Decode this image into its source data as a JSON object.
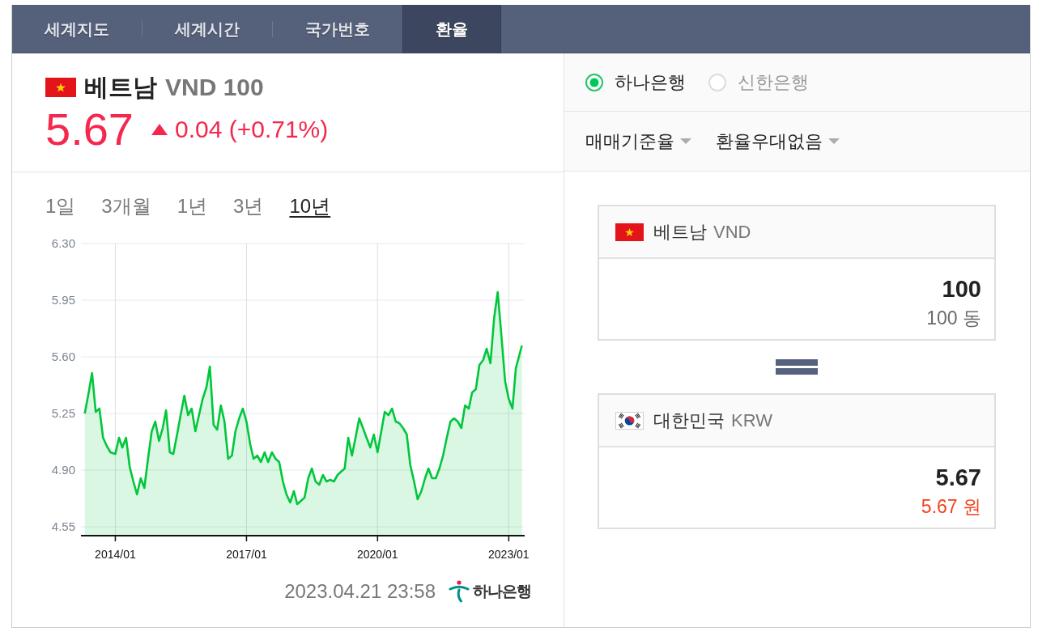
{
  "tabs": [
    {
      "label": "세계지도",
      "selected": false
    },
    {
      "label": "세계시간",
      "selected": false
    },
    {
      "label": "국가번호",
      "selected": false
    },
    {
      "label": "환율",
      "selected": true
    }
  ],
  "quote": {
    "country": "베트남",
    "currency": "VND 100",
    "price": "5.67",
    "change": {
      "up": true,
      "text": "0.04 (+0.71%)"
    }
  },
  "chart_panel": {
    "periods": [
      {
        "label": "1일",
        "selected": false
      },
      {
        "label": "3개월",
        "selected": false
      },
      {
        "label": "1년",
        "selected": false
      },
      {
        "label": "3년",
        "selected": false
      },
      {
        "label": "10년",
        "selected": true
      }
    ],
    "chart_data": [
      {
        "type": "area",
        "color": "#00c73c",
        "grid": true,
        "xlim": [
          "2013-03-20",
          "2023-05-14"
        ],
        "ylim": [
          4.5,
          6.3
        ],
        "yticks": [
          {
            "value": 4.55,
            "label": "4.55"
          },
          {
            "value": 4.9,
            "label": "4.90"
          },
          {
            "value": 5.25,
            "label": "5.25"
          },
          {
            "value": 5.6,
            "label": "5.60"
          },
          {
            "value": 5.95,
            "label": "5.95"
          },
          {
            "value": 6.3,
            "label": "6.30"
          }
        ],
        "xticks": [
          {
            "value": "2014-01-01",
            "label": "2014/01"
          },
          {
            "value": "2017-01-01",
            "label": "2017/01"
          },
          {
            "value": "2020-01-01",
            "label": "2020/01"
          },
          {
            "value": "2023-01-01",
            "label": "2023/01"
          }
        ],
        "x": [
          "2013-04-21",
          "2013-05-21",
          "2013-06-21",
          "2013-07-21",
          "2013-08-21",
          "2013-09-21",
          "2013-10-21",
          "2013-11-21",
          "2014-01-01",
          "2014-02-01",
          "2014-03-01",
          "2014-04-01",
          "2014-05-01",
          "2014-06-01",
          "2014-07-01",
          "2014-08-01",
          "2014-09-01",
          "2014-10-01",
          "2014-11-01",
          "2014-12-01",
          "2015-01-01",
          "2015-02-01",
          "2015-03-01",
          "2015-04-01",
          "2015-05-01",
          "2015-06-01",
          "2015-07-01",
          "2015-08-01",
          "2015-09-01",
          "2015-10-01",
          "2015-11-01",
          "2015-12-01",
          "2016-01-01",
          "2016-02-01",
          "2016-03-01",
          "2016-04-01",
          "2016-05-01",
          "2016-06-01",
          "2016-07-01",
          "2016-08-01",
          "2016-09-01",
          "2016-10-01",
          "2016-11-01",
          "2016-12-01",
          "2017-01-01",
          "2017-02-01",
          "2017-03-01",
          "2017-04-01",
          "2017-05-01",
          "2017-06-01",
          "2017-07-01",
          "2017-08-01",
          "2017-09-01",
          "2017-10-01",
          "2017-11-01",
          "2017-12-01",
          "2018-01-01",
          "2018-02-01",
          "2018-03-01",
          "2018-04-01",
          "2018-05-01",
          "2018-06-01",
          "2018-07-01",
          "2018-08-01",
          "2018-09-01",
          "2018-10-01",
          "2018-11-01",
          "2018-12-01",
          "2019-01-01",
          "2019-02-01",
          "2019-03-01",
          "2019-04-01",
          "2019-05-01",
          "2019-06-01",
          "2019-07-01",
          "2019-08-01",
          "2019-09-01",
          "2019-10-01",
          "2019-11-01",
          "2019-12-01",
          "2020-01-01",
          "2020-02-01",
          "2020-03-01",
          "2020-04-01",
          "2020-05-01",
          "2020-06-01",
          "2020-07-01",
          "2020-08-01",
          "2020-09-01",
          "2020-10-01",
          "2020-11-01",
          "2020-12-01",
          "2021-01-01",
          "2021-02-01",
          "2021-03-01",
          "2021-04-01",
          "2021-05-01",
          "2021-06-01",
          "2021-07-01",
          "2021-08-01",
          "2021-09-01",
          "2021-10-01",
          "2021-11-01",
          "2021-12-01",
          "2022-01-01",
          "2022-02-01",
          "2022-03-01",
          "2022-04-01",
          "2022-05-01",
          "2022-06-01",
          "2022-07-01",
          "2022-08-01",
          "2022-09-01",
          "2022-10-01",
          "2022-11-01",
          "2022-12-01",
          "2023-01-01",
          "2023-02-01",
          "2023-03-01",
          "2023-04-21"
        ],
        "values": [
          5.25,
          5.37,
          5.5,
          5.26,
          5.28,
          5.1,
          5.05,
          5.01,
          5.0,
          5.1,
          5.04,
          5.1,
          4.92,
          4.83,
          4.75,
          4.85,
          4.79,
          4.97,
          5.14,
          5.2,
          5.08,
          5.16,
          5.27,
          5.01,
          5.0,
          5.12,
          5.24,
          5.36,
          5.24,
          5.28,
          5.14,
          5.24,
          5.34,
          5.41,
          5.54,
          5.18,
          5.15,
          5.3,
          5.2,
          4.97,
          4.99,
          5.14,
          5.22,
          5.28,
          5.2,
          5.06,
          4.97,
          4.99,
          4.95,
          5.01,
          4.95,
          5.01,
          4.97,
          4.95,
          4.83,
          4.75,
          4.7,
          4.77,
          4.69,
          4.71,
          4.73,
          4.85,
          4.91,
          4.83,
          4.81,
          4.87,
          4.83,
          4.84,
          4.83,
          4.87,
          4.89,
          4.91,
          5.1,
          4.99,
          5.1,
          5.22,
          5.16,
          5.1,
          5.04,
          5.12,
          5.01,
          5.14,
          5.26,
          5.24,
          5.28,
          5.2,
          5.19,
          5.16,
          5.12,
          4.93,
          4.83,
          4.72,
          4.77,
          4.85,
          4.91,
          4.85,
          4.85,
          4.91,
          4.99,
          5.1,
          5.2,
          5.22,
          5.2,
          5.16,
          5.3,
          5.28,
          5.38,
          5.4,
          5.55,
          5.58,
          5.65,
          5.56,
          5.84,
          6.0,
          5.73,
          5.45,
          5.34,
          5.28,
          5.53,
          5.67
        ]
      }
    ],
    "timestamp": "2023.04.21 23:58",
    "source_logo": "하나은행"
  },
  "rate_settings": {
    "banks": [
      {
        "label": "하나은행",
        "selected": true
      },
      {
        "label": "신한은행",
        "selected": false
      }
    ],
    "dropdowns": [
      "매매기준율",
      "환율우대없음"
    ]
  },
  "converter": [
    {
      "kind": "source",
      "country": "베트남",
      "currency": "VND",
      "amount": "100",
      "amount_text": "100 동"
    },
    {
      "kind": "result",
      "country": "대한민국",
      "currency": "KRW",
      "amount": "5.67",
      "amount_text": "5.67 원"
    }
  ]
}
